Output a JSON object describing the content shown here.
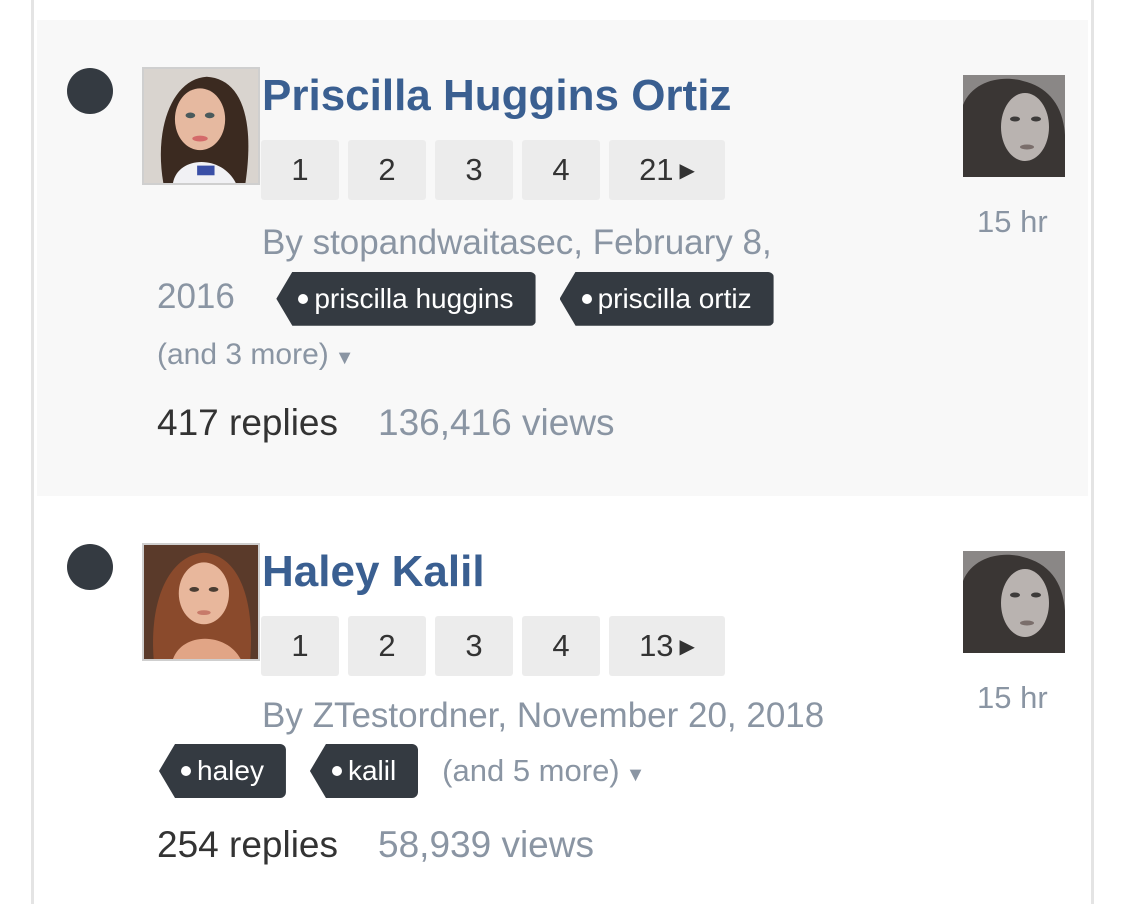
{
  "topics": [
    {
      "title": "Priscilla Huggins Ortiz",
      "pages": [
        "1",
        "2",
        "3",
        "4",
        "21"
      ],
      "byline_1": "By stopandwaitasec, February 8,",
      "byline_2": "2016",
      "tags": [
        "priscilla huggins",
        "priscilla ortiz"
      ],
      "more_tags": "(and 3 more)",
      "replies": "417 replies",
      "views": "136,416 views",
      "last_time": "15 hr"
    },
    {
      "title": "Haley Kalil",
      "pages": [
        "1",
        "2",
        "3",
        "4",
        "13"
      ],
      "byline": "By ZTestordner, November 20, 2018",
      "tags": [
        "haley",
        "kalil"
      ],
      "more_tags": "(and 5 more)",
      "replies": "254 replies",
      "views": "58,939 views",
      "last_time": "15 hr"
    }
  ],
  "icons": {
    "unread": "unread-dot-icon",
    "next_page": "triangle-right-icon",
    "more_tags": "caret-down-icon"
  },
  "colors": {
    "title": "#3a5f91",
    "tag_bg": "#343a41",
    "muted": "#8a95a3",
    "row_alt": "#f8f8f8"
  }
}
